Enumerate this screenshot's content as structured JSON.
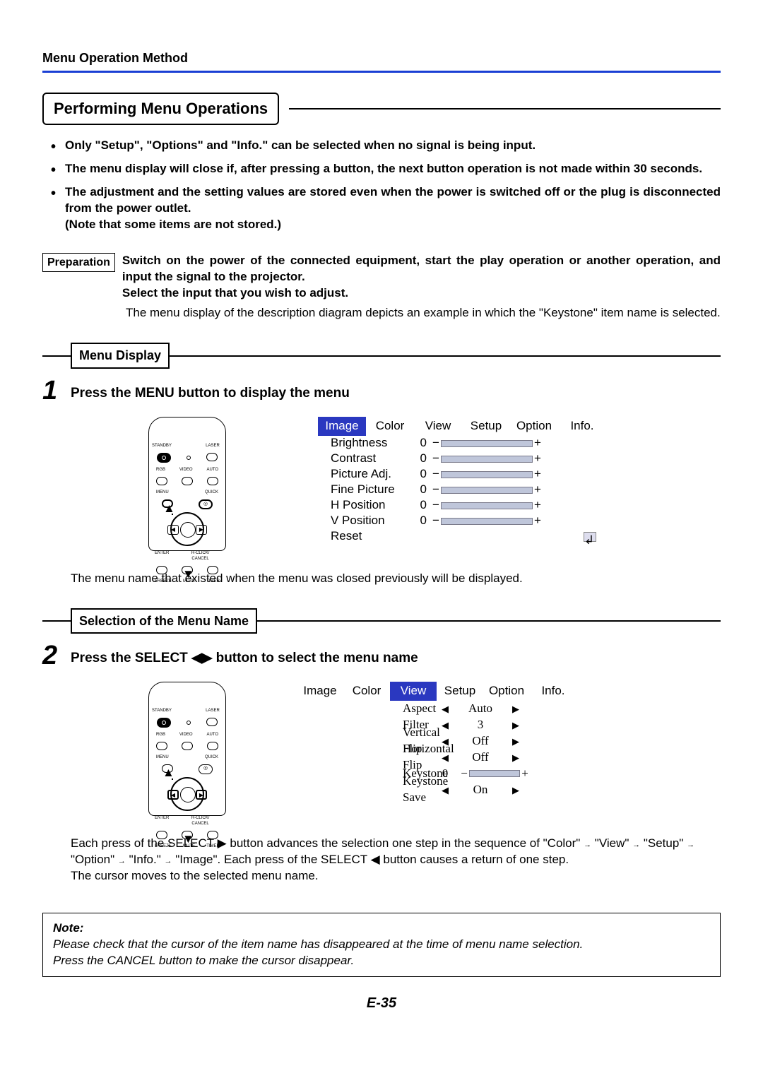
{
  "header": {
    "title": "Menu Operation Method"
  },
  "section": {
    "title": "Performing Menu Operations"
  },
  "bullets": {
    "b1": "Only \"Setup\", \"Options\" and \"Info.\" can be selected when no signal is being input.",
    "b2": "The menu display will close if, after pressing a button, the next button operation is not made within 30 seconds.",
    "b3": "The adjustment and the setting values are stored even when the power is switched off or the plug is disconnected from the power outlet.",
    "b3_note": "(Note that some items are not stored.)"
  },
  "prep": {
    "label": "Preparation",
    "line1": "Switch on the power of the connected equipment, start the play operation or another operation, and input the signal to the projector.",
    "line2": "Select the input that you wish to adjust.",
    "line3": "The menu display of the description diagram depicts an example in which the \"Keystone\" item name is selected."
  },
  "sub1": {
    "title": "Menu Display"
  },
  "step1": {
    "num": "1",
    "text": "Press the MENU button to display the menu"
  },
  "menu1": {
    "tabs": [
      "Image",
      "Color",
      "View",
      "Setup",
      "Option",
      "Info."
    ],
    "active": 0,
    "items": [
      {
        "label": "Brightness",
        "val": "0"
      },
      {
        "label": "Contrast",
        "val": "0"
      },
      {
        "label": "Picture Adj.",
        "val": "0"
      },
      {
        "label": "Fine Picture",
        "val": "0"
      },
      {
        "label": "H Position",
        "val": "0"
      },
      {
        "label": "V Position",
        "val": "0"
      }
    ],
    "reset": "Reset"
  },
  "after_step1": "The menu name that existed when the menu was closed previously will be displayed.",
  "sub2": {
    "title": "Selection of the Menu Name"
  },
  "step2": {
    "num": "2",
    "text_a": "Press the SELECT ",
    "text_b": " button to select the menu name"
  },
  "menu2": {
    "tabs": [
      "Image",
      "Color",
      "View",
      "Setup",
      "Option",
      "Info."
    ],
    "active": 2,
    "items": [
      {
        "label": "Aspect",
        "type": "lr",
        "val": "Auto"
      },
      {
        "label": "Filter",
        "type": "lr",
        "val": "3"
      },
      {
        "label": "Vertical Flip",
        "type": "lr",
        "val": "Off"
      },
      {
        "label": "Horizontal Flip",
        "type": "lr",
        "val": "Off"
      },
      {
        "label": "Keystone",
        "type": "slider",
        "val": "0"
      },
      {
        "label": "Keystone Save",
        "type": "lr",
        "val": "On"
      }
    ]
  },
  "after_step2_l1a": "Each press of the SELECT ",
  "after_step2_l1b": " button advances the selection one step in the sequence of \"Color\" ",
  "after_step2_l1c": " \"View\" ",
  "after_step2_l1d": " \"Setup\" ",
  "after_step2_l2a": "\"Option\" ",
  "after_step2_l2b": " \"Info.\" ",
  "after_step2_l2c": " \"Image\". Each press of the SELECT ",
  "after_step2_l2d": " button causes a return of one step.",
  "after_step2_l3": "The cursor moves to the selected menu name.",
  "note": {
    "title": "Note:",
    "l1": "Please check that the cursor of the item name has disappeared at the time of menu name selection.",
    "l2": "Press the CANCEL button to make the cursor disappear."
  },
  "pagenum": "E-35",
  "remote": {
    "standby": "STANDBY",
    "laser": "LASER",
    "rgb": "RGB",
    "video": "VIDEO",
    "auto": "AUTO",
    "menu": "MENU",
    "quick": "QUICK",
    "enter": "ENTER",
    "rclick": "R-CLICK/",
    "cancel": "CANCEL",
    "freeze": "FREEZE",
    "mute": "MUTE",
    "timer": "TIMER"
  }
}
